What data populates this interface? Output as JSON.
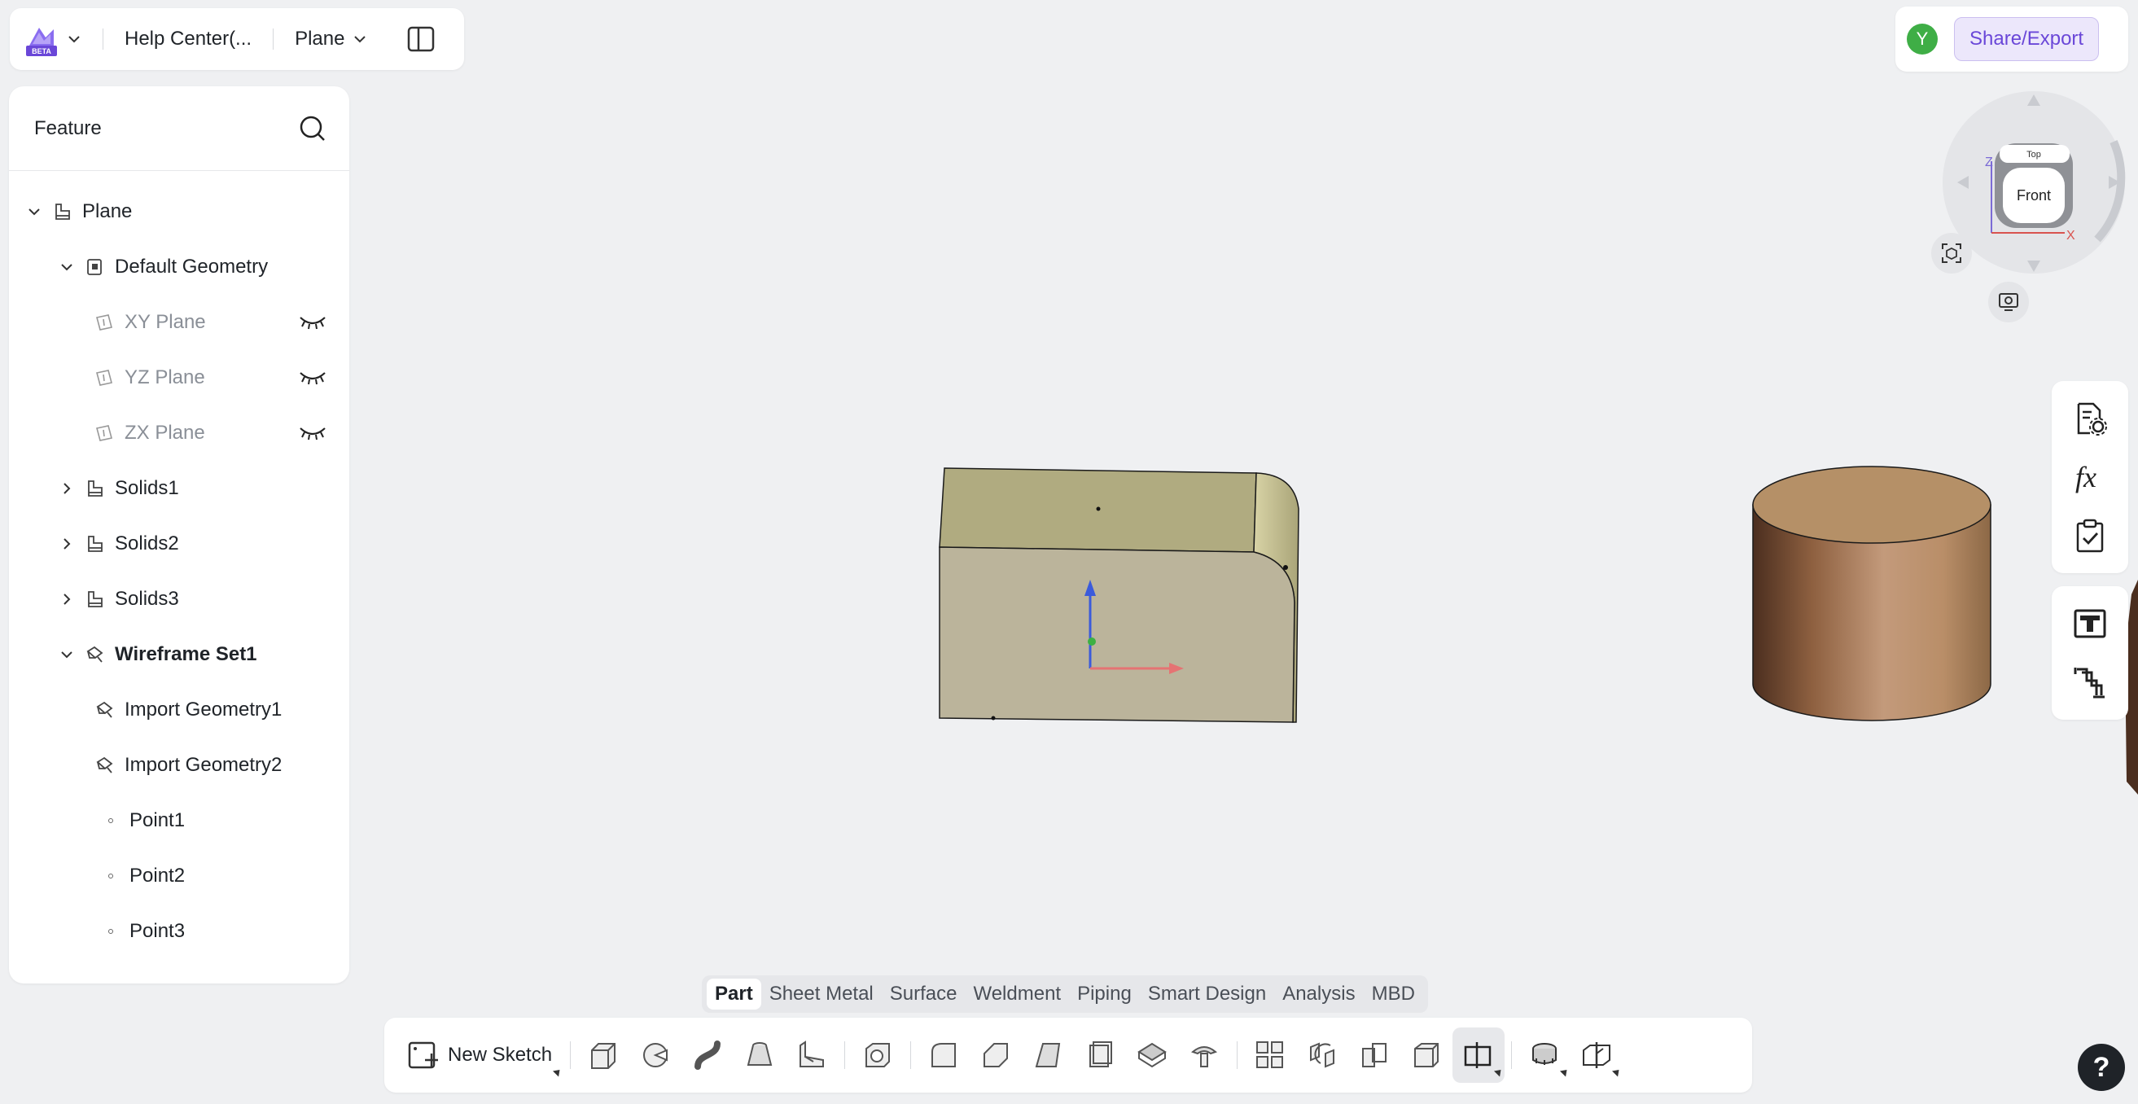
{
  "header": {
    "logo_badge": "BETA",
    "doc_title": "Help Center(...",
    "part_name": "Plane"
  },
  "account": {
    "avatar_initial": "Y",
    "share_label": "Share/Export"
  },
  "feature_panel": {
    "title": "Feature",
    "tree": [
      {
        "label": "Plane",
        "level": 0,
        "expanded": true,
        "icon": "part-icon"
      },
      {
        "label": "Default Geometry",
        "level": 1,
        "expanded": true,
        "icon": "default-geometry-icon"
      },
      {
        "label": "XY Plane",
        "level": 2,
        "icon": "plane-icon",
        "hidden": true
      },
      {
        "label": "YZ Plane",
        "level": 2,
        "icon": "plane-icon",
        "hidden": true
      },
      {
        "label": "ZX Plane",
        "level": 2,
        "icon": "plane-icon",
        "hidden": true
      },
      {
        "label": "Solids1",
        "level": 1,
        "expanded": false,
        "icon": "solid-body-icon"
      },
      {
        "label": "Solids2",
        "level": 1,
        "expanded": false,
        "icon": "solid-body-icon"
      },
      {
        "label": "Solids3",
        "level": 1,
        "expanded": false,
        "icon": "solid-body-icon"
      },
      {
        "label": "Wireframe Set1",
        "level": 1,
        "expanded": true,
        "icon": "wireframe-icon"
      },
      {
        "label": "Import Geometry1",
        "level": 2,
        "icon": "import-geometry-icon"
      },
      {
        "label": "Import Geometry2",
        "level": 2,
        "icon": "import-geometry-icon"
      },
      {
        "label": "Point1",
        "level": 2,
        "icon": "point-icon"
      },
      {
        "label": "Point2",
        "level": 2,
        "icon": "point-icon"
      },
      {
        "label": "Point3",
        "level": 2,
        "icon": "point-icon"
      }
    ]
  },
  "view_cube": {
    "face_front": "Front",
    "face_top": "Top",
    "axis_z": "Z",
    "axis_x": "X"
  },
  "tabs": {
    "items": [
      "Part",
      "Sheet Metal",
      "Surface",
      "Weldment",
      "Piping",
      "Smart Design",
      "Analysis",
      "MBD"
    ],
    "active": "Part"
  },
  "toolbar": {
    "new_sketch_label": "New Sketch",
    "tools": [
      "extrude-icon",
      "revolve-icon",
      "sweep-icon",
      "loft-icon",
      "rib-icon",
      "shell-icon",
      "fillet-icon",
      "chamfer-icon",
      "draft-icon",
      "thicken-icon",
      "split-icon",
      "hole-icon",
      "pattern-icon",
      "mirror-icon",
      "move-body-icon",
      "combine-icon",
      "reference-plane-icon",
      "measure-icon",
      "section-view-icon"
    ]
  },
  "colors": {
    "accent": "#6a47d8",
    "avatar": "#3fae46",
    "box_top": "#b0ab80",
    "box_front": "#bbb49b",
    "cylinder_top": "#b59067"
  }
}
